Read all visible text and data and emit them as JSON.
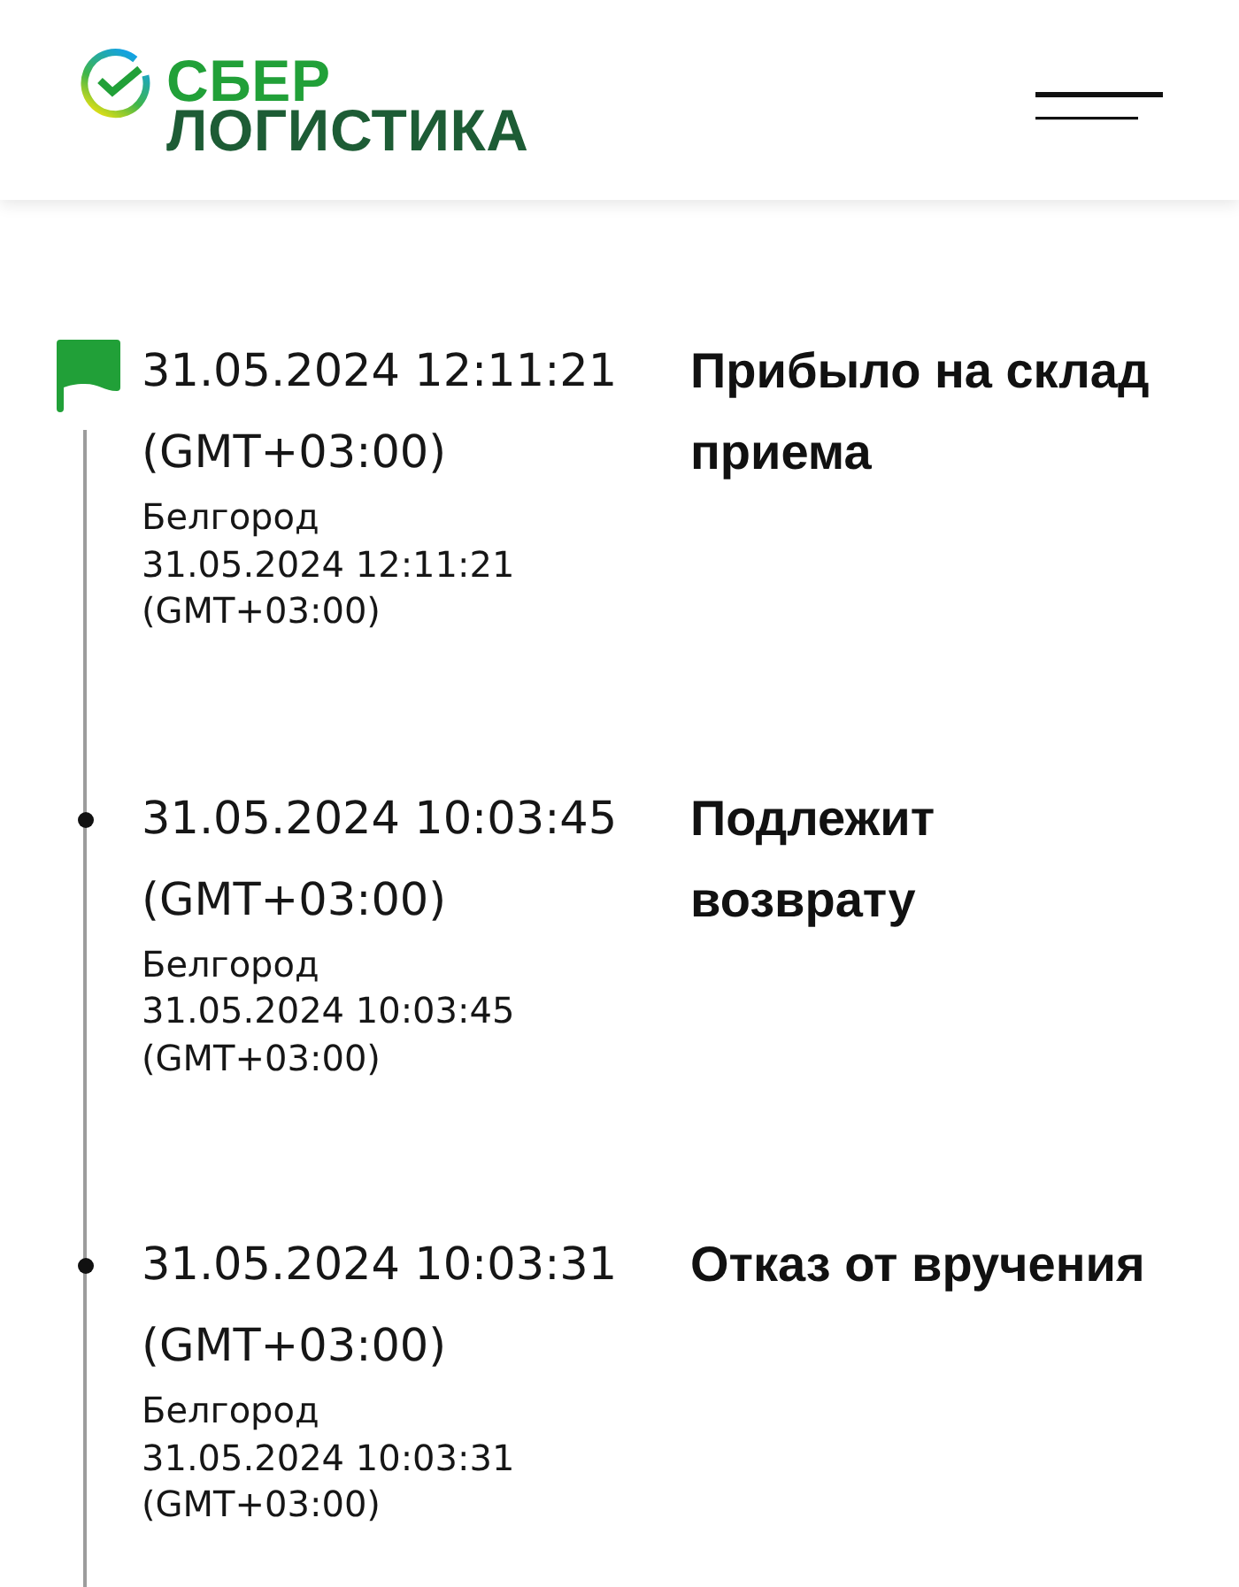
{
  "header": {
    "logo": {
      "lines": [
        "СБЕР",
        "ЛОГИСТИКА"
      ]
    }
  },
  "events": [
    {
      "kind": "flag",
      "datetime": "31.05.2024 12:11:21 (GMT+03:00)",
      "city": "Белгород",
      "local_datetime": "31.05.2024 12:11:21 (GMT+03:00)",
      "status": "Прибыло на склад приема"
    },
    {
      "kind": "dot",
      "datetime": "31.05.2024 10:03:45 (GMT+03:00)",
      "city": "Белгород",
      "local_datetime": "31.05.2024 10:03:45 (GMT+03:00)",
      "status": "Подлежит возврату"
    },
    {
      "kind": "dot",
      "datetime": "31.05.2024 10:03:31 (GMT+03:00)",
      "city": "Белгород",
      "local_datetime": "31.05.2024 10:03:31 (GMT+03:00)",
      "status": "Отказ от вручения"
    }
  ]
}
